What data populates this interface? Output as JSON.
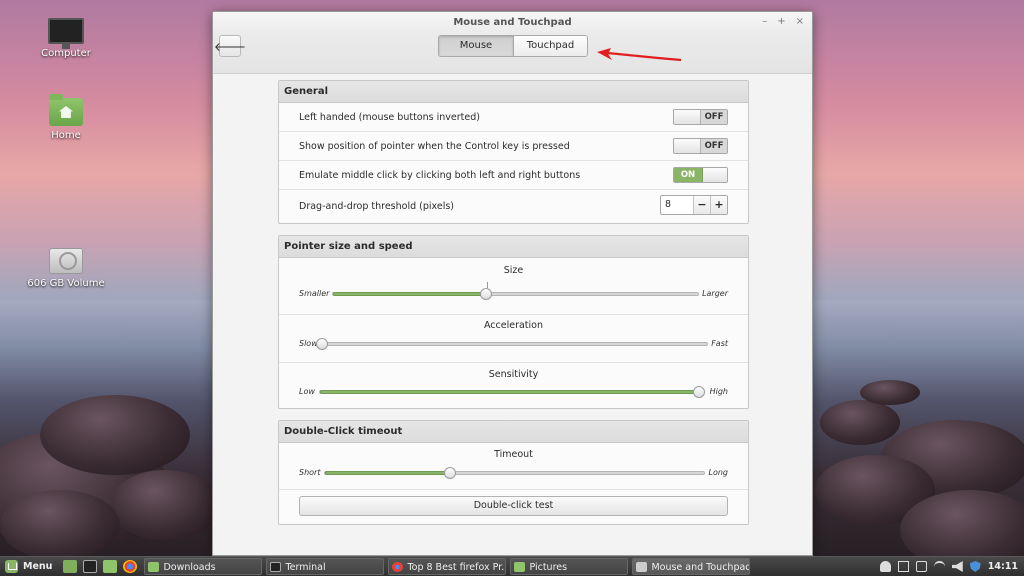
{
  "desktop": {
    "icons": [
      {
        "label": "Computer"
      },
      {
        "label": "Home"
      },
      {
        "label": "606 GB Volume"
      }
    ]
  },
  "window": {
    "title": "Mouse and Touchpad",
    "controls": {
      "minimize": "–",
      "maximize": "+",
      "close": "×"
    },
    "back_glyph": "🡐",
    "tabs": [
      {
        "label": "Mouse",
        "active": true
      },
      {
        "label": "Touchpad",
        "active": false
      }
    ],
    "general": {
      "header": "General",
      "rows": [
        {
          "label": "Left handed (mouse buttons inverted)",
          "state": "OFF"
        },
        {
          "label": "Show position of pointer when the Control key is pressed",
          "state": "OFF"
        },
        {
          "label": "Emulate middle click by clicking both left and right buttons",
          "state": "ON"
        },
        {
          "label": "Drag-and-drop threshold (pixels)",
          "value": "8",
          "minus": "−",
          "plus": "+"
        }
      ]
    },
    "pointer": {
      "header": "Pointer size and speed",
      "size": {
        "title": "Size",
        "min_label": "Smaller",
        "max_label": "Larger",
        "value": 0.42
      },
      "acceleration": {
        "title": "Acceleration",
        "min_label": "Slow",
        "max_label": "Fast",
        "value": 0.0
      },
      "sensitivity": {
        "title": "Sensitivity",
        "min_label": "Low",
        "max_label": "High",
        "value": 1.0
      }
    },
    "double_click": {
      "header": "Double-Click timeout",
      "timeout": {
        "title": "Timeout",
        "min_label": "Short",
        "max_label": "Long",
        "value": 0.33
      },
      "test_button": "Double-click test"
    }
  },
  "taskbar": {
    "menu_label": "Menu",
    "tasks": [
      {
        "label": "Downloads"
      },
      {
        "label": "Terminal"
      },
      {
        "label": "Top 8 Best firefox Pr..."
      },
      {
        "label": "Pictures"
      },
      {
        "label": "Mouse and Touchpad"
      }
    ],
    "clock": "14:11"
  },
  "colors": {
    "accent": "#8ab466",
    "annotation_arrow": "#e02020"
  }
}
